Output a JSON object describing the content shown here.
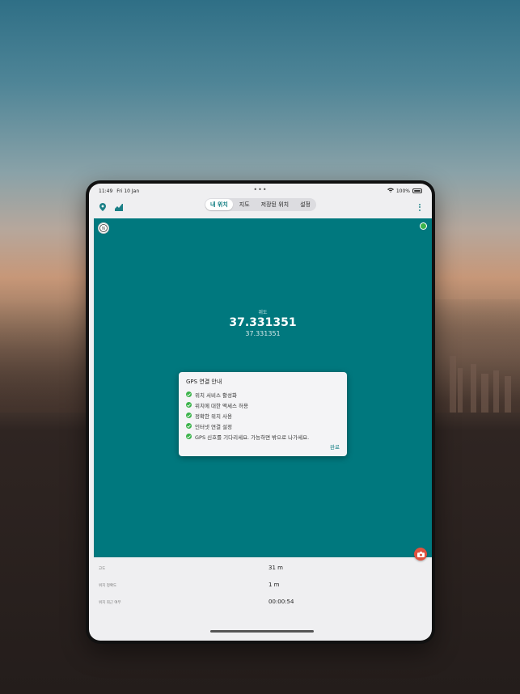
{
  "status": {
    "time": "11:49",
    "date": "Fri 10 Jan",
    "battery": "100%"
  },
  "tabs": [
    {
      "label": "내 위치",
      "active": true
    },
    {
      "label": "지도",
      "active": false
    },
    {
      "label": "저장된 위치",
      "active": false
    },
    {
      "label": "설정",
      "active": false
    }
  ],
  "icons": {
    "location": "pin-icon",
    "chart": "altitude-chart-icon",
    "compass": "compass-icon",
    "more": "more-vertical-icon",
    "camera": "camera-icon",
    "check": "check-circle-icon",
    "wifi": "wifi-icon",
    "battery": "battery-icon"
  },
  "colors": {
    "accent": "#0d7b80",
    "map_bg": "#00787e",
    "success": "#3bb34a",
    "camera": "#e0523f"
  },
  "coordinates": {
    "label": "위도",
    "value": "37.331351",
    "sub": "37.331351"
  },
  "dialog": {
    "title": "GPS 연결 안내",
    "items": [
      "위치 서비스 활성화",
      "위치에 대한 액세스 허용",
      "정확한 위치 사용",
      "인터넷 연결 설정",
      "GPS 신호를 기다리세요. 가능하면 밖으로 나가세요."
    ],
    "done_label": "완료"
  },
  "info": {
    "rows": [
      {
        "label": "고도",
        "value": "31 m"
      },
      {
        "label": "위치 정확도",
        "value": "1 m"
      },
      {
        "label": "위치 최근 여부",
        "value": "00:00:54"
      }
    ]
  }
}
